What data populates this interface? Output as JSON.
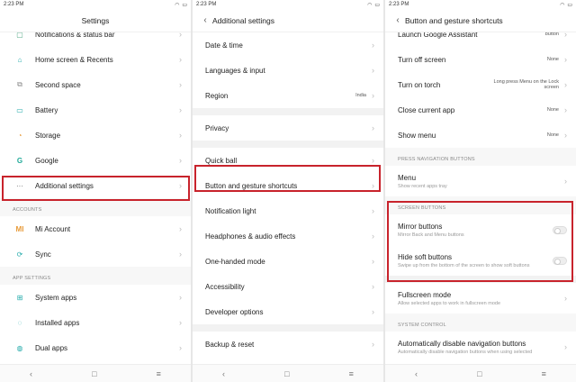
{
  "status": {
    "time": "2:23 PM"
  },
  "panel1": {
    "title": "Settings",
    "rows_top": [
      {
        "icon": "notification-icon",
        "glyph": "▢",
        "label": "Notifications & status bar",
        "cls": "c-notif"
      },
      {
        "icon": "home-icon",
        "glyph": "⌂",
        "label": "Home screen & Recents",
        "cls": "c-home"
      },
      {
        "icon": "second-space-icon",
        "glyph": "⧉",
        "label": "Second space",
        "cls": "c-second"
      },
      {
        "icon": "battery-icon",
        "glyph": "▭",
        "label": "Battery",
        "cls": "c-battery"
      },
      {
        "icon": "storage-icon",
        "glyph": "◔",
        "label": "Storage",
        "cls": "c-storage"
      },
      {
        "icon": "google-icon",
        "glyph": "G",
        "label": "Google",
        "cls": "c-google"
      },
      {
        "icon": "more-icon",
        "glyph": "···",
        "label": "Additional settings",
        "cls": "c-additional"
      }
    ],
    "section_accounts": "ACCOUNTS",
    "rows_accounts": [
      {
        "icon": "mi-icon",
        "glyph": "MI",
        "label": "Mi Account",
        "cls": "c-mi"
      },
      {
        "icon": "sync-icon",
        "glyph": "⟳",
        "label": "Sync",
        "cls": "c-sync"
      }
    ],
    "section_apps": "APP SETTINGS",
    "rows_apps": [
      {
        "icon": "apps-grid-icon",
        "glyph": "⊞",
        "label": "System apps",
        "cls": "c-sysapps"
      },
      {
        "icon": "installed-apps-icon",
        "glyph": "◌",
        "label": "Installed apps",
        "cls": "c-installed"
      },
      {
        "icon": "dual-apps-icon",
        "glyph": "◍",
        "label": "Dual apps",
        "cls": "c-dual"
      }
    ]
  },
  "panel2": {
    "title": "Additional settings",
    "group1": [
      {
        "label": "Date & time",
        "value": ""
      },
      {
        "label": "Languages & input",
        "value": ""
      },
      {
        "label": "Region",
        "value": "India"
      }
    ],
    "group2": [
      {
        "label": "Privacy",
        "value": ""
      }
    ],
    "group3": [
      {
        "label": "Quick ball",
        "value": ""
      },
      {
        "label": "Button and gesture shortcuts",
        "value": ""
      },
      {
        "label": "Notification light",
        "value": ""
      },
      {
        "label": "Headphones & audio effects",
        "value": ""
      },
      {
        "label": "One-handed mode",
        "value": ""
      },
      {
        "label": "Accessibility",
        "value": ""
      },
      {
        "label": "Developer options",
        "value": ""
      }
    ],
    "group4": [
      {
        "label": "Backup & reset",
        "value": ""
      }
    ]
  },
  "panel3": {
    "title": "Button and gesture shortcuts",
    "group1": [
      {
        "label": "Launch Google Assistant",
        "value": "button"
      },
      {
        "label": "Turn off screen",
        "value": "None"
      },
      {
        "label": "Turn on torch",
        "value": "Long press Menu on the Lock screen"
      },
      {
        "label": "Close current app",
        "value": "None"
      },
      {
        "label": "Show menu",
        "value": "None"
      }
    ],
    "section_press": "PRESS NAVIGATION BUTTONS",
    "menu": {
      "label": "Menu",
      "sub": "Show recent apps tray"
    },
    "section_screen": "SCREEN BUTTONS",
    "mirror": {
      "label": "Mirror buttons",
      "sub": "Mirror Back and Menu buttons"
    },
    "hide": {
      "label": "Hide soft buttons",
      "sub": "Swipe up from the bottom of the screen to show soft buttons"
    },
    "fullscreen": {
      "label": "Fullscreen mode",
      "sub": "Allow selected apps to work in fullscreen mode"
    },
    "section_system": "SYSTEM CONTROL",
    "autodisable": {
      "label": "Automatically disable navigation buttons",
      "sub": "Automatically disable navigation buttons when using selected"
    }
  },
  "nav": {
    "back": "‹",
    "home": "□",
    "menu": "≡"
  },
  "colors": {
    "highlight": "#c8232c",
    "accent": "#2aa"
  }
}
